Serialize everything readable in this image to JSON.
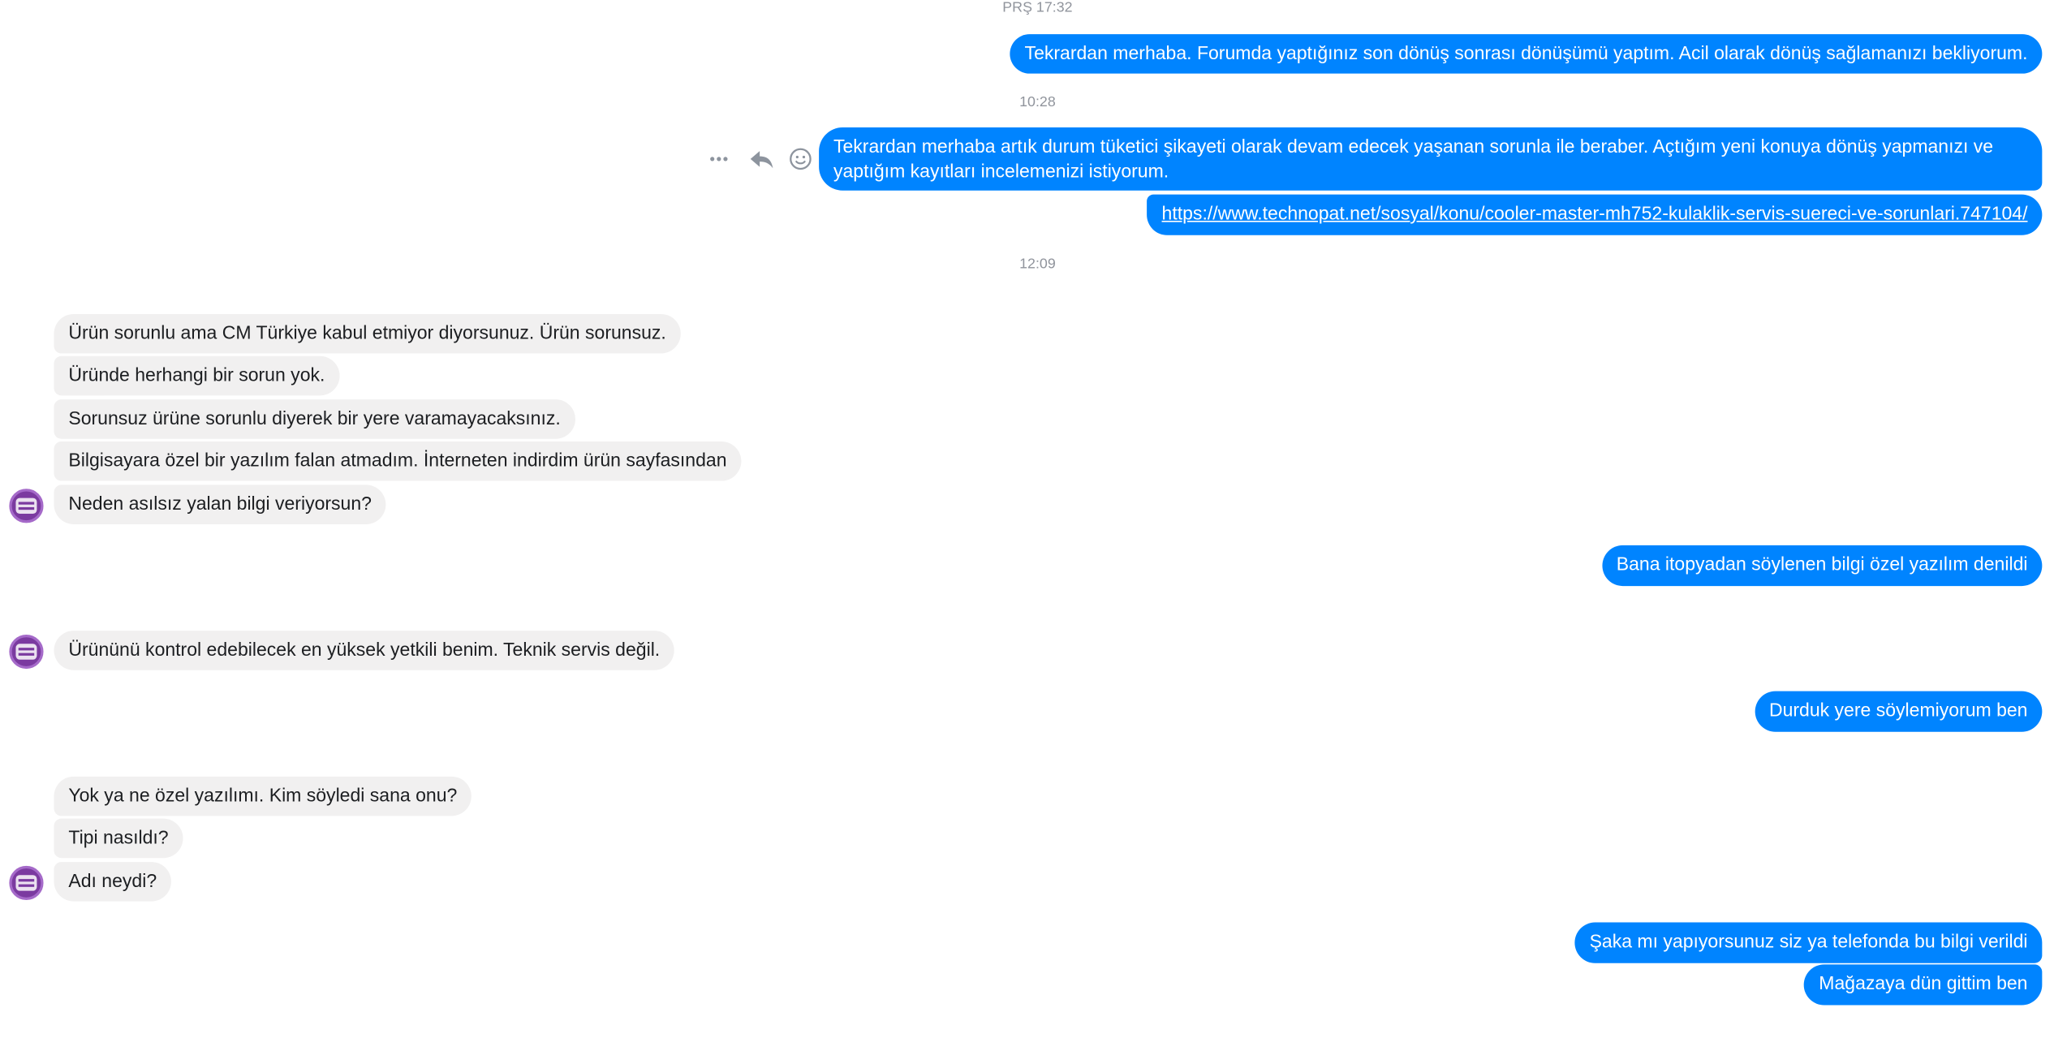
{
  "timestamps": [
    "PRŞ 17:32",
    "10:28",
    "12:09"
  ],
  "messages": {
    "m1": "Tekrardan merhaba. Forumda yaptığınız son dönüş sonrası dönüşümü yaptım. Acil olarak dönüş sağlamanızı bekliyorum.",
    "m2": "Tekrardan merhaba artık durum tüketici şikayeti olarak devam edecek yaşanan sorunla ile beraber. Açtığım yeni konuya dönüş yapmanızı ve yaptığım kayıtları incelemenizi istiyorum.",
    "m3_link": "https://www.technopat.net/sosyal/konu/cooler-master-mh752-kulaklik-servis-suereci-ve-sorunlari.747104/",
    "m4": "Ürün sorunlu ama CM Türkiye kabul etmiyor diyorsunuz. Ürün sorunsuz.",
    "m5": "Üründe herhangi bir sorun yok.",
    "m6": "Sorunsuz ürüne sorunlu diyerek bir yere varamayacaksınız.",
    "m7": "Bilgisayara özel bir yazılım falan atmadım. İnterneten indirdim ürün sayfasından",
    "m8": "Neden asılsız yalan bilgi veriyorsun?",
    "m9": "Bana itopyadan söylenen bilgi özel yazılım denildi",
    "m10": "Ürününü kontrol edebilecek en yüksek yetkili benim. Teknik servis değil.",
    "m11": "Durduk yere söylemiyorum ben",
    "m12": "Yok ya ne özel yazılımı. Kim söyledi sana onu?",
    "m13": "Tipi nasıldı?",
    "m14": "Adı neydi?",
    "m15": "Şaka mı yapıyorsunuz siz ya telefonda bu bilgi verildi",
    "m16": "Mağazaya dün gittim ben"
  },
  "icons": {
    "more": "more-options-icon",
    "reply": "reply-icon",
    "react": "emoji-reaction-icon",
    "avatar": "cooler-master-avatar"
  },
  "colors": {
    "outgoing_bubble": "#0084ff",
    "incoming_bubble": "#f1f0f0",
    "timestamp": "#90949c",
    "avatar": "#7b3aa0"
  }
}
